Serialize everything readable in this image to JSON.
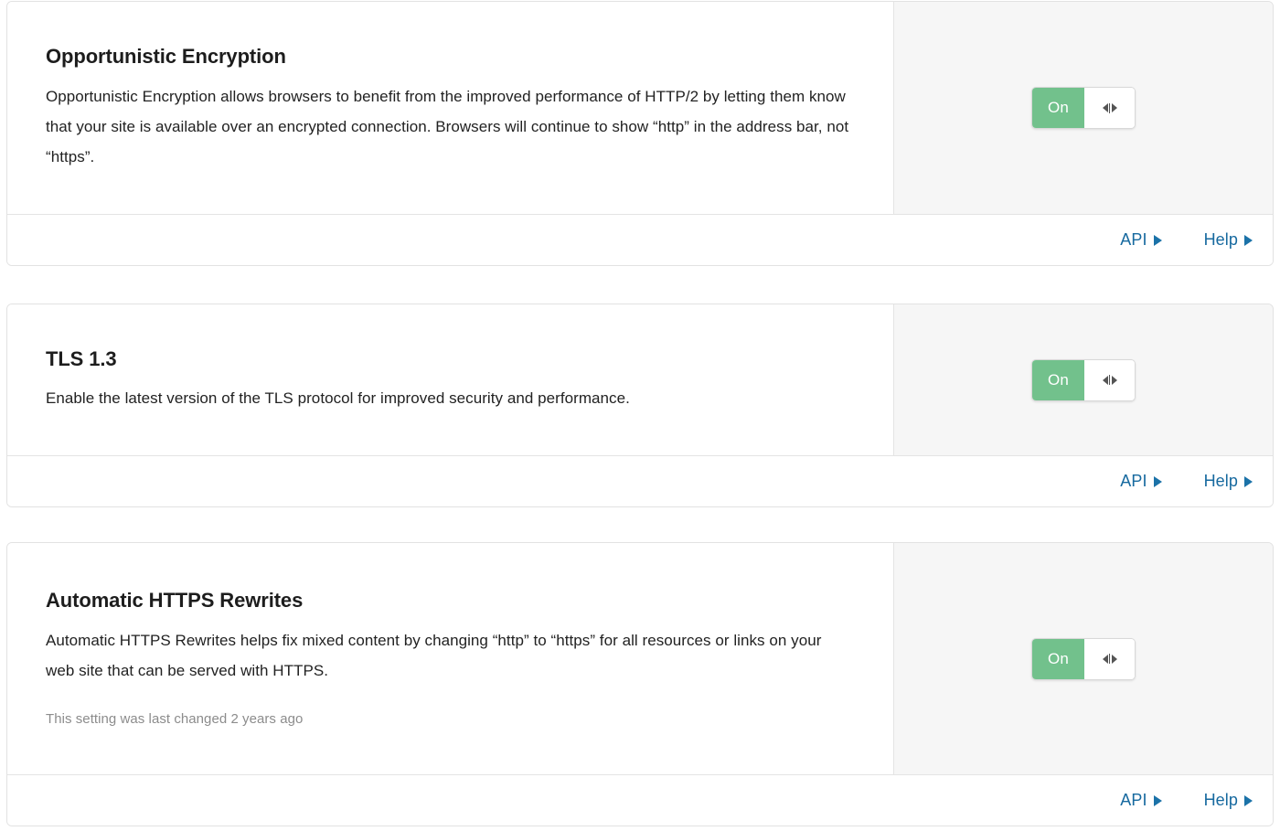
{
  "cards": [
    {
      "id": "opportunistic-encryption",
      "title": "Opportunistic Encryption",
      "description": "Opportunistic Encryption allows browsers to benefit from the improved performance of HTTP/2 by letting them know that your site is available over an encrypted connection. Browsers will continue to show “http” in the address bar, not “https”.",
      "note": "",
      "toggle": {
        "state_label": "On",
        "state": "on",
        "knob_icon": "drag-handle-arrows-icon"
      },
      "footer": {
        "api_label": "API",
        "help_label": "Help",
        "caret_icon": "caret-right-icon"
      }
    },
    {
      "id": "tls-1-3",
      "title": "TLS 1.3",
      "description": "Enable the latest version of the TLS protocol for improved security and performance.",
      "note": "",
      "toggle": {
        "state_label": "On",
        "state": "on",
        "knob_icon": "drag-handle-arrows-icon"
      },
      "footer": {
        "api_label": "API",
        "help_label": "Help",
        "caret_icon": "caret-right-icon"
      }
    },
    {
      "id": "automatic-https-rewrites",
      "title": "Automatic HTTPS Rewrites",
      "description": "Automatic HTTPS Rewrites helps fix mixed content by changing “http” to “https” for all resources or links on your web site that can be served with HTTPS.",
      "note": "This setting was last changed 2 years ago",
      "toggle": {
        "state_label": "On",
        "state": "on",
        "knob_icon": "drag-handle-arrows-icon"
      },
      "footer": {
        "api_label": "API",
        "help_label": "Help",
        "caret_icon": "caret-right-icon"
      }
    }
  ],
  "colors": {
    "toggle_on_green": "#72c18c",
    "link_blue": "#16699f",
    "panel_gray": "#f6f6f6",
    "border_gray": "#e2e2e2",
    "title_text": "#1d1d1d",
    "body_text": "#222222",
    "muted_text": "#8c8c8c"
  }
}
